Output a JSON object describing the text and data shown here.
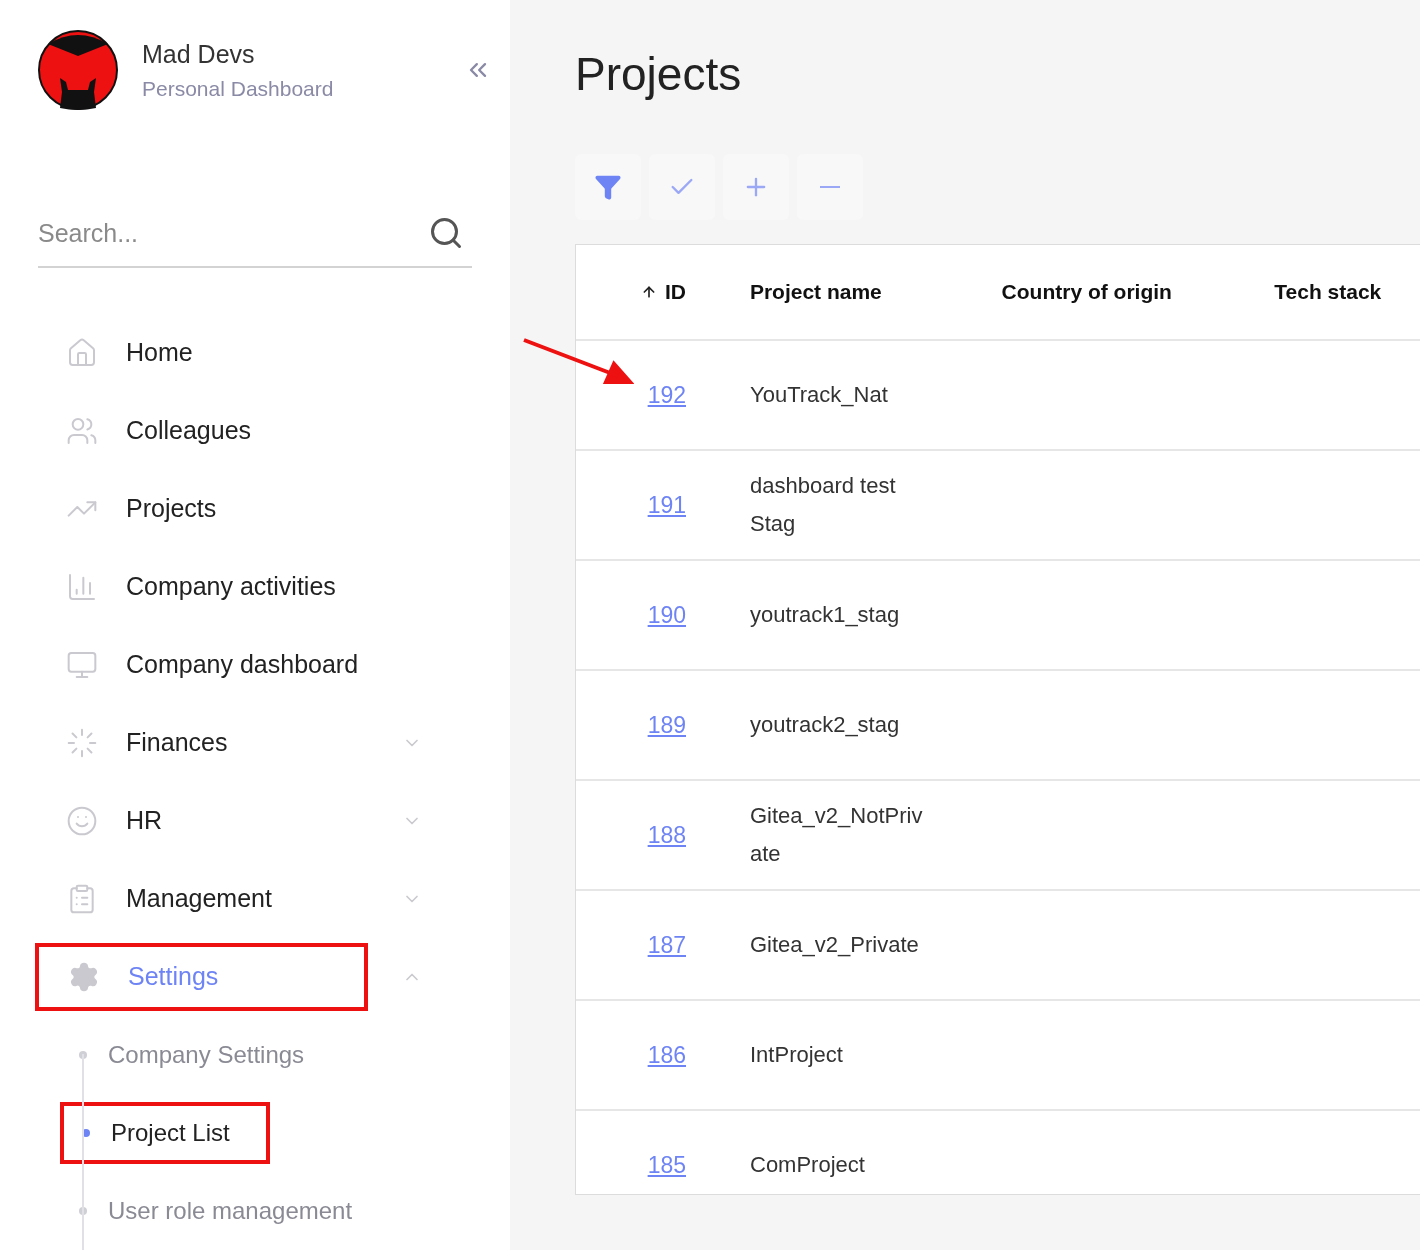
{
  "brand": {
    "name": "Mad Devs",
    "subtitle": "Personal Dashboard"
  },
  "search": {
    "placeholder": "Search..."
  },
  "nav": [
    {
      "label": "Home",
      "kind": "link",
      "selected": false,
      "annotated": false
    },
    {
      "label": "Colleagues",
      "kind": "link",
      "selected": false,
      "annotated": false
    },
    {
      "label": "Projects",
      "kind": "link",
      "selected": false,
      "annotated": false
    },
    {
      "label": "Company activities",
      "kind": "link",
      "selected": false,
      "annotated": false
    },
    {
      "label": "Company dashboard",
      "kind": "link",
      "selected": false,
      "annotated": false
    },
    {
      "label": "Finances",
      "kind": "group",
      "selected": false,
      "expanded": false,
      "annotated": false
    },
    {
      "label": "HR",
      "kind": "group",
      "selected": false,
      "expanded": false,
      "annotated": false
    },
    {
      "label": "Management",
      "kind": "group",
      "selected": false,
      "expanded": false,
      "annotated": false
    },
    {
      "label": "Settings",
      "kind": "group",
      "selected": true,
      "expanded": true,
      "annotated": true,
      "children": [
        {
          "label": "Company Settings",
          "selected": false,
          "annotated": false
        },
        {
          "label": "Project List",
          "selected": true,
          "annotated": true
        },
        {
          "label": "User role management",
          "selected": false,
          "annotated": false
        }
      ]
    }
  ],
  "page": {
    "title": "Projects"
  },
  "table": {
    "columns": [
      {
        "label": "ID",
        "sorted": true
      },
      {
        "label": "Project name",
        "sorted": false
      },
      {
        "label": "Country of origin",
        "sorted": false
      },
      {
        "label": "Tech stack",
        "sorted": false
      }
    ],
    "rows": [
      {
        "id": "192",
        "name": [
          "YouTrack_Nat"
        ],
        "pointed": true
      },
      {
        "id": "191",
        "name": [
          "dashboard test",
          "Stag"
        ],
        "pointed": false
      },
      {
        "id": "190",
        "name": [
          "youtrack1_stag"
        ],
        "pointed": false
      },
      {
        "id": "189",
        "name": [
          "youtrack2_stag"
        ],
        "pointed": false
      },
      {
        "id": "188",
        "name": [
          "Gitea_v2_NotPriv",
          "ate"
        ],
        "pointed": false
      },
      {
        "id": "187",
        "name": [
          "Gitea_v2_Private"
        ],
        "pointed": false
      },
      {
        "id": "186",
        "name": [
          "IntProject"
        ],
        "pointed": false
      },
      {
        "id": "185",
        "name": [
          "ComProject"
        ],
        "pointed": false
      }
    ]
  }
}
